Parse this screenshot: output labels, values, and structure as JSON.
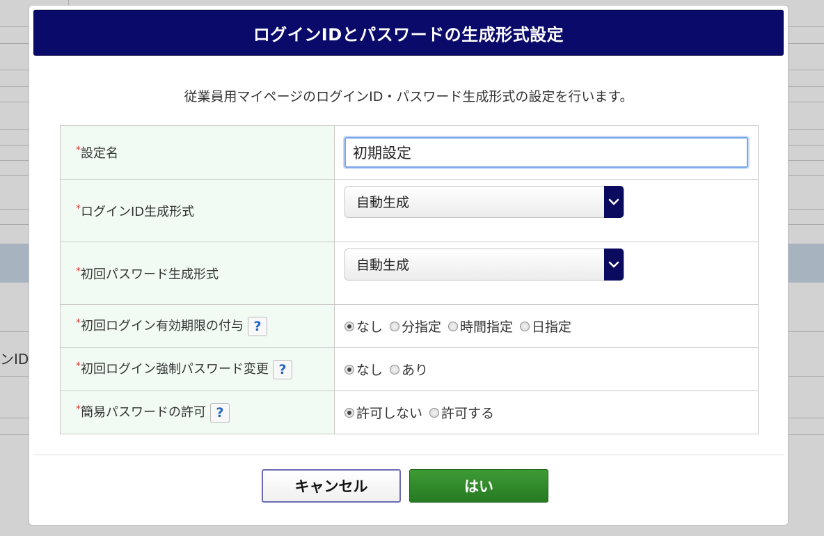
{
  "background": {
    "partial_text": "ンID"
  },
  "dialog": {
    "title": "ログインIDとパスワードの生成形式設定",
    "intro": "従業員用マイページのログインID・パスワード生成形式の設定を行います。"
  },
  "form": {
    "required_mark": "*",
    "setting_name": {
      "label": "設定名",
      "value": "初期設定"
    },
    "login_id_format": {
      "label": "ログインID生成形式",
      "selected": "自動生成"
    },
    "initial_password_format": {
      "label": "初回パスワード生成形式",
      "selected": "自動生成"
    },
    "initial_login_expiry": {
      "label": "初回ログイン有効期限の付与",
      "help": "?",
      "options": [
        "なし",
        "分指定",
        "時間指定",
        "日指定"
      ],
      "selected_index": 0
    },
    "force_password_change": {
      "label": "初回ログイン強制パスワード変更",
      "help": "?",
      "options": [
        "なし",
        "あり"
      ],
      "selected_index": 0
    },
    "simple_password": {
      "label": "簡易パスワードの許可",
      "help": "?",
      "options": [
        "許可しない",
        "許可する"
      ],
      "selected_index": 0
    }
  },
  "buttons": {
    "cancel": "キャンセル",
    "ok": "はい"
  },
  "colors": {
    "header_bg": "#0a0a6a",
    "label_bg": "#f1fbf3",
    "required": "#e53935",
    "ok_button": "#2f8a29",
    "help_icon": "#1f65c3"
  },
  "icons": {
    "select_arrow": "chevron-down-icon",
    "help": "help-icon"
  }
}
